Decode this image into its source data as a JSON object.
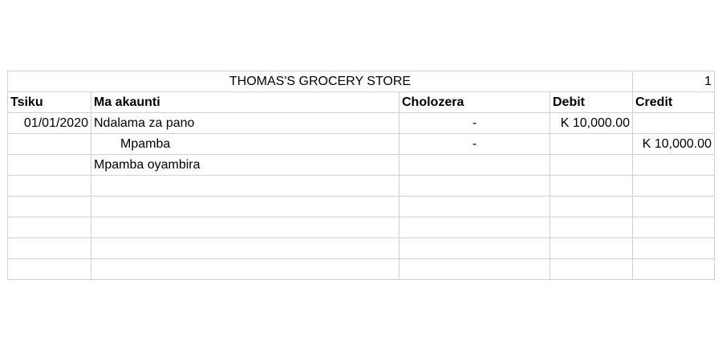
{
  "title": "THOMAS'S GROCERY STORE",
  "page_number": "1",
  "headers": {
    "date": "Tsiku",
    "account": "Ma akaunti",
    "description": "Cholozera",
    "debit": "Debit",
    "credit": "Credit"
  },
  "rows": [
    {
      "date": "01/01/2020",
      "account": "Ndalama za pano",
      "description": "-",
      "debit": "K 10,000.00",
      "credit": ""
    },
    {
      "date": "",
      "account": "Mpamba",
      "description": "-",
      "debit": "",
      "credit": "K 10,000.00"
    },
    {
      "date": "",
      "account": "Mpamba oyambira",
      "description": "",
      "debit": "",
      "credit": ""
    }
  ]
}
